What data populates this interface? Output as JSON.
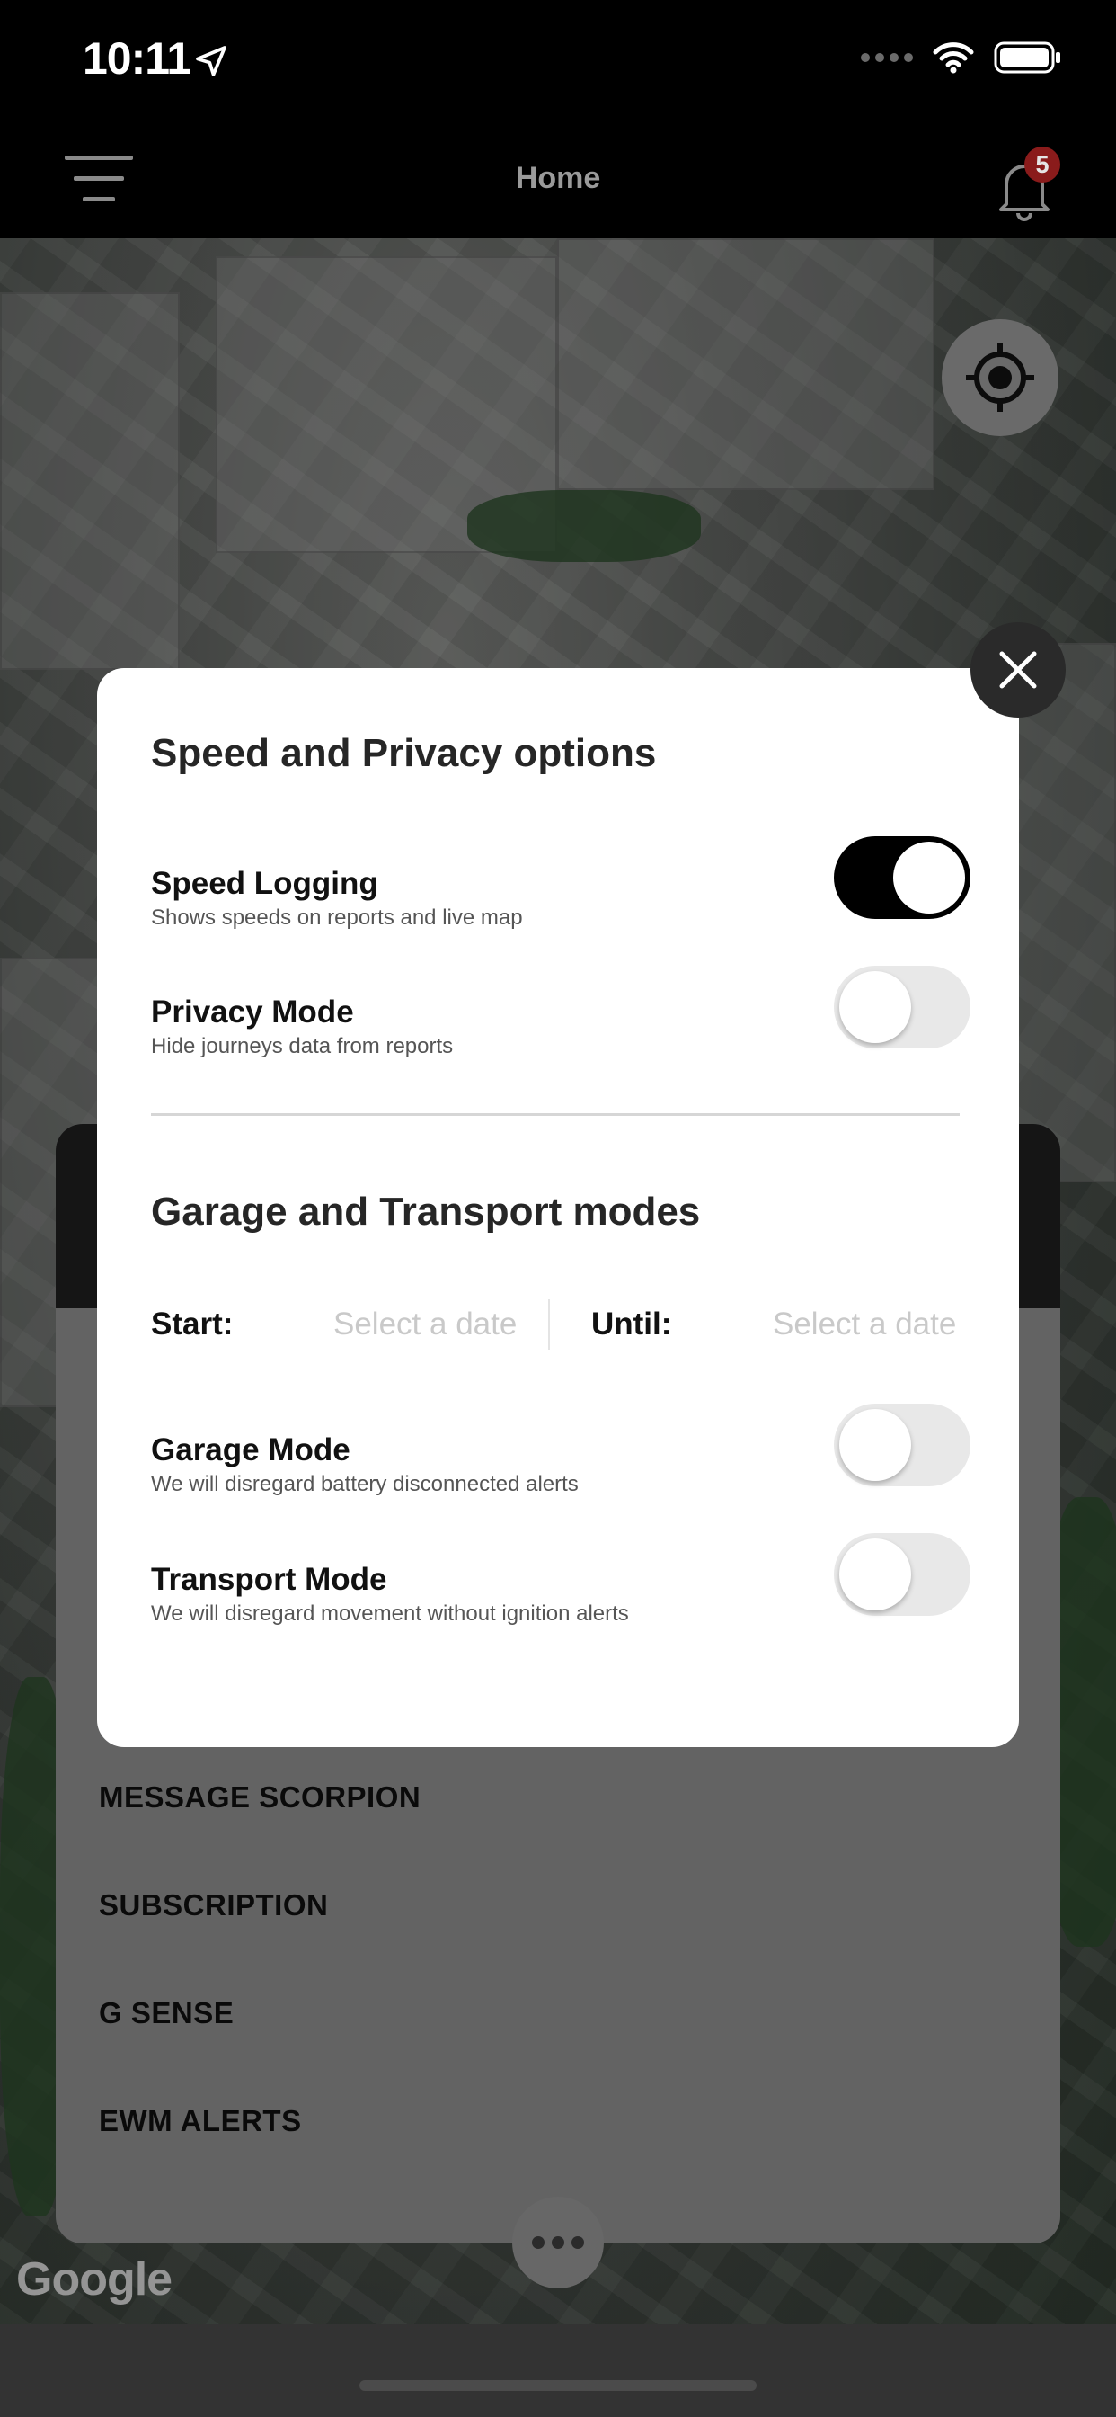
{
  "status_bar": {
    "time": "10:11"
  },
  "header": {
    "title": "Home",
    "notification_count": "5"
  },
  "modal": {
    "privacy_section_title": "Speed and Privacy options",
    "options": [
      {
        "label": "Speed Logging",
        "description": "Shows speeds on reports and live map",
        "enabled": true
      },
      {
        "label": "Privacy Mode",
        "description": "Hide journeys data from reports",
        "enabled": false
      }
    ],
    "garage_section_title": "Garage and Transport modes",
    "start_label": "Start:",
    "start_placeholder": "Select a date",
    "until_label": "Until:",
    "until_placeholder": "Select a date",
    "modes": [
      {
        "label": "Garage Mode",
        "description": "We will disregard battery disconnected alerts",
        "enabled": false
      },
      {
        "label": "Transport Mode",
        "description": "We will disregard movement without ignition alerts",
        "enabled": false
      }
    ]
  },
  "menu": {
    "items": [
      "MESSAGE SCORPION",
      "SUBSCRIPTION",
      "G SENSE",
      "EWM ALERTS"
    ]
  },
  "map": {
    "attribution": "Google"
  },
  "icons": {
    "menu": "hamburger-menu-icon",
    "notifications": "bell-icon",
    "locate": "crosshair-icon",
    "close": "close-icon",
    "more": "more-dots-icon",
    "wifi": "wifi-icon",
    "battery": "battery-icon",
    "location": "location-arrow-icon"
  }
}
